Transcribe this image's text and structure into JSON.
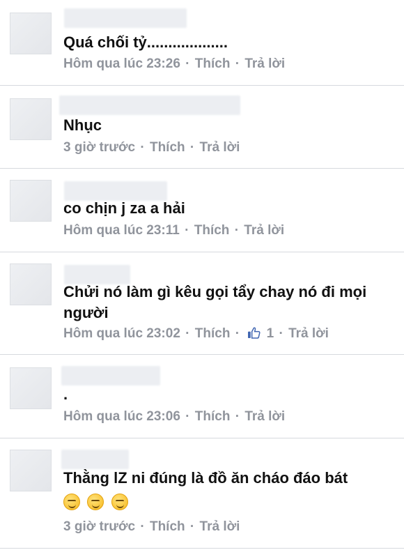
{
  "comments": [
    {
      "text": "Quá  chối tỷ...................",
      "time": "Hôm qua lúc 23:26",
      "like_label": "Thích",
      "reply_label": "Trả lời",
      "separator": "·"
    },
    {
      "text": "Nhục",
      "time": "3 giờ trước",
      "like_label": "Thích",
      "reply_label": "Trả lời",
      "separator": "·"
    },
    {
      "text": "co  chịn j za a hải",
      "time": "Hôm qua lúc 23:11",
      "like_label": "Thích",
      "reply_label": "Trả lời",
      "separator": "·"
    },
    {
      "text": "Chửi nó làm gì kêu gọi tẩy chay nó đi mọi người",
      "time": "Hôm qua lúc 23:02",
      "like_label": "Thích",
      "like_count": "1",
      "reply_label": "Trả lời",
      "separator": "·",
      "like_icon": "thumbs-up-icon"
    },
    {
      "text": ".",
      "time": "Hôm qua lúc 23:06",
      "like_label": "Thích",
      "reply_label": "Trả lời",
      "separator": "·"
    },
    {
      "text": "Thằng lZ ni đúng là đồ  ăn cháo đáo bát",
      "emoji": [
        "smirk-emoji",
        "smirk-emoji",
        "smirk-emoji"
      ],
      "time": "3 giờ trước",
      "like_label": "Thích",
      "reply_label": "Trả lời",
      "separator": "·"
    }
  ],
  "colors": {
    "text": "#111111",
    "meta": "#90949c",
    "divider": "#d6d9de",
    "like_blue": "#4267b2"
  }
}
